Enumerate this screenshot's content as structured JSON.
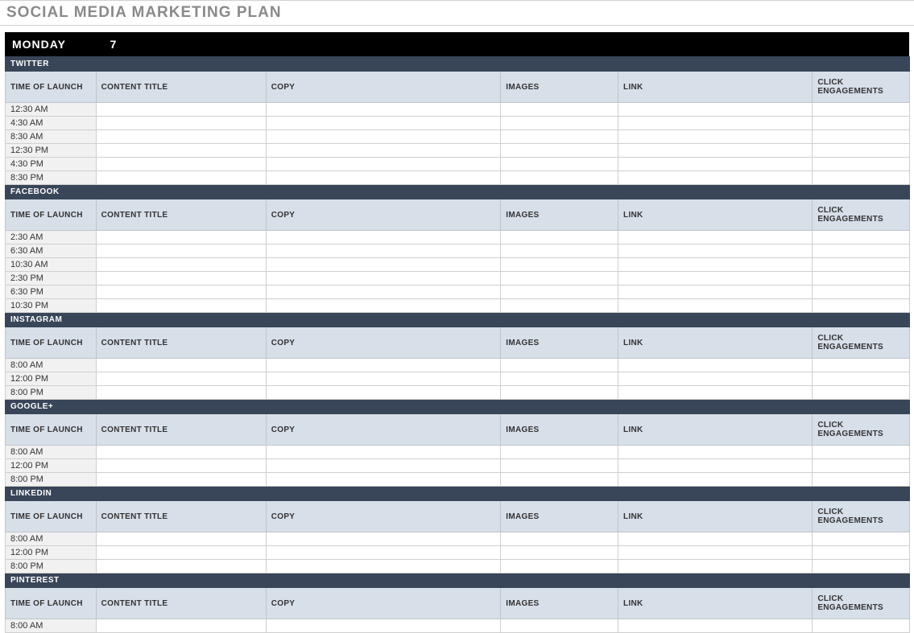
{
  "title": "SOCIAL MEDIA MARKETING PLAN",
  "day": {
    "name": "MONDAY",
    "num": "7"
  },
  "columns": {
    "time": "TIME OF LAUNCH",
    "content": "CONTENT TITLE",
    "copy": "COPY",
    "images": "IMAGES",
    "link": "LINK",
    "click": "CLICK ENGAGEMENTS"
  },
  "networks": [
    {
      "name": "TWITTER",
      "rows": [
        {
          "time": "12:30 AM",
          "content": "",
          "copy": "",
          "images": "",
          "link": "",
          "click": ""
        },
        {
          "time": "4:30 AM",
          "content": "",
          "copy": "",
          "images": "",
          "link": "",
          "click": ""
        },
        {
          "time": "8:30 AM",
          "content": "",
          "copy": "",
          "images": "",
          "link": "",
          "click": ""
        },
        {
          "time": "12:30 PM",
          "content": "",
          "copy": "",
          "images": "",
          "link": "",
          "click": ""
        },
        {
          "time": "4:30 PM",
          "content": "",
          "copy": "",
          "images": "",
          "link": "",
          "click": ""
        },
        {
          "time": "8:30 PM",
          "content": "",
          "copy": "",
          "images": "",
          "link": "",
          "click": ""
        }
      ]
    },
    {
      "name": "FACEBOOK",
      "rows": [
        {
          "time": "2:30 AM",
          "content": "",
          "copy": "",
          "images": "",
          "link": "",
          "click": ""
        },
        {
          "time": "6:30 AM",
          "content": "",
          "copy": "",
          "images": "",
          "link": "",
          "click": ""
        },
        {
          "time": "10:30 AM",
          "content": "",
          "copy": "",
          "images": "",
          "link": "",
          "click": ""
        },
        {
          "time": "2:30 PM",
          "content": "",
          "copy": "",
          "images": "",
          "link": "",
          "click": ""
        },
        {
          "time": "6:30 PM",
          "content": "",
          "copy": "",
          "images": "",
          "link": "",
          "click": ""
        },
        {
          "time": "10:30 PM",
          "content": "",
          "copy": "",
          "images": "",
          "link": "",
          "click": ""
        }
      ]
    },
    {
      "name": "INSTAGRAM",
      "rows": [
        {
          "time": "8:00 AM",
          "content": "",
          "copy": "",
          "images": "",
          "link": "",
          "click": ""
        },
        {
          "time": "12:00 PM",
          "content": "",
          "copy": "",
          "images": "",
          "link": "",
          "click": ""
        },
        {
          "time": "8:00 PM",
          "content": "",
          "copy": "",
          "images": "",
          "link": "",
          "click": ""
        }
      ]
    },
    {
      "name": "GOOGLE+",
      "rows": [
        {
          "time": "8:00 AM",
          "content": "",
          "copy": "",
          "images": "",
          "link": "",
          "click": ""
        },
        {
          "time": "12:00 PM",
          "content": "",
          "copy": "",
          "images": "",
          "link": "",
          "click": ""
        },
        {
          "time": "8:00 PM",
          "content": "",
          "copy": "",
          "images": "",
          "link": "",
          "click": ""
        }
      ]
    },
    {
      "name": "LINKEDIN",
      "rows": [
        {
          "time": "8:00 AM",
          "content": "",
          "copy": "",
          "images": "",
          "link": "",
          "click": ""
        },
        {
          "time": "12:00 PM",
          "content": "",
          "copy": "",
          "images": "",
          "link": "",
          "click": ""
        },
        {
          "time": "8:00 PM",
          "content": "",
          "copy": "",
          "images": "",
          "link": "",
          "click": ""
        }
      ]
    },
    {
      "name": "PINTEREST",
      "rows": [
        {
          "time": "8:00 AM",
          "content": "",
          "copy": "",
          "images": "",
          "link": "",
          "click": ""
        }
      ]
    }
  ]
}
